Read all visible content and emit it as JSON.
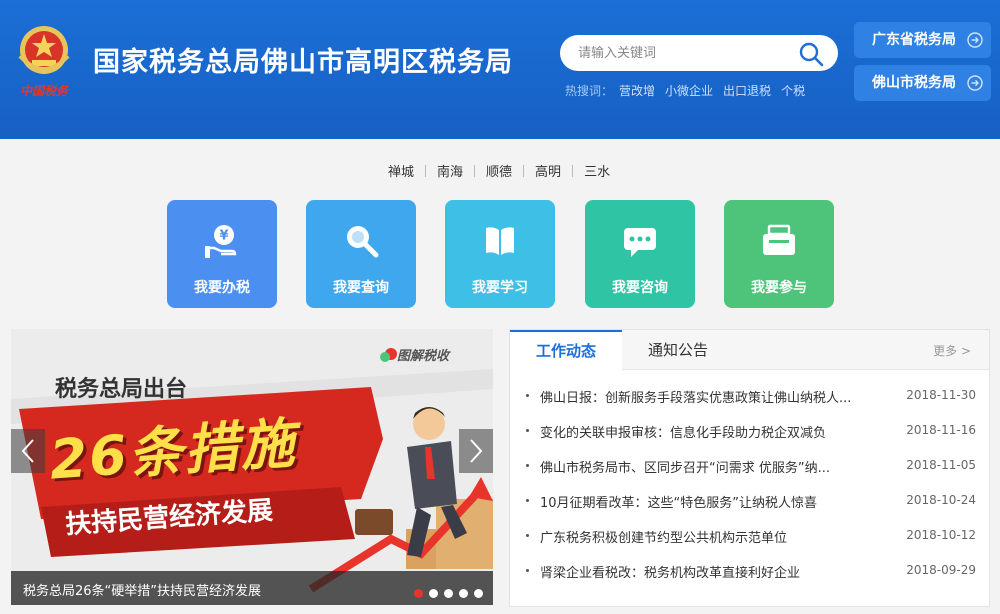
{
  "header": {
    "emblem_text": "中国税务",
    "title": "国家税务总局佛山市高明区税务局",
    "search_placeholder": "请输入关键词",
    "hot_label": "热搜词：",
    "hot_words": [
      "营改增",
      "小微企业",
      "出口退税",
      "个税"
    ],
    "links": [
      "广东省税务局",
      "佛山市税务局"
    ]
  },
  "districts": [
    "禅城",
    "南海",
    "顺德",
    "高明",
    "三水"
  ],
  "services": [
    {
      "label": "我要办税",
      "color": "#4b8ff0",
      "icon": "tax-coin-hand-icon"
    },
    {
      "label": "我要查询",
      "color": "#3fa7ee",
      "icon": "magnifier-icon"
    },
    {
      "label": "我要学习",
      "color": "#3dbfe6",
      "icon": "book-icon"
    },
    {
      "label": "我要咨询",
      "color": "#2fc4a4",
      "icon": "chat-bubble-icon"
    },
    {
      "label": "我要参与",
      "color": "#4dc47a",
      "icon": "ballot-box-icon"
    }
  ],
  "carousel": {
    "brand": "图解税收",
    "heading": "税务总局出台",
    "headline": "26条措施",
    "subline": "扶持民营经济发展",
    "caption": "税务总局26条“硬举措”扶持民营经济发展",
    "slide_count": 5,
    "active_slide": 1
  },
  "news": {
    "tabs": [
      "工作动态",
      "通知公告"
    ],
    "more": "更多 >",
    "items": [
      {
        "title": "佛山日报：创新服务手段落实优惠政策让佛山纳税人...",
        "date": "2018-11-30"
      },
      {
        "title": "变化的关联申报审核：信息化手段助力税企双减负",
        "date": "2018-11-16"
      },
      {
        "title": "佛山市税务局市、区同步召开“问需求 优服务”纳...",
        "date": "2018-11-05"
      },
      {
        "title": "10月征期看改革：这些“特色服务”让纳税人惊喜",
        "date": "2018-10-24"
      },
      {
        "title": "广东税务积极创建节约型公共机构示范单位",
        "date": "2018-10-12"
      },
      {
        "title": "肾梁企业看税改：税务机构改革直接利好企业",
        "date": "2018-09-29"
      }
    ]
  }
}
